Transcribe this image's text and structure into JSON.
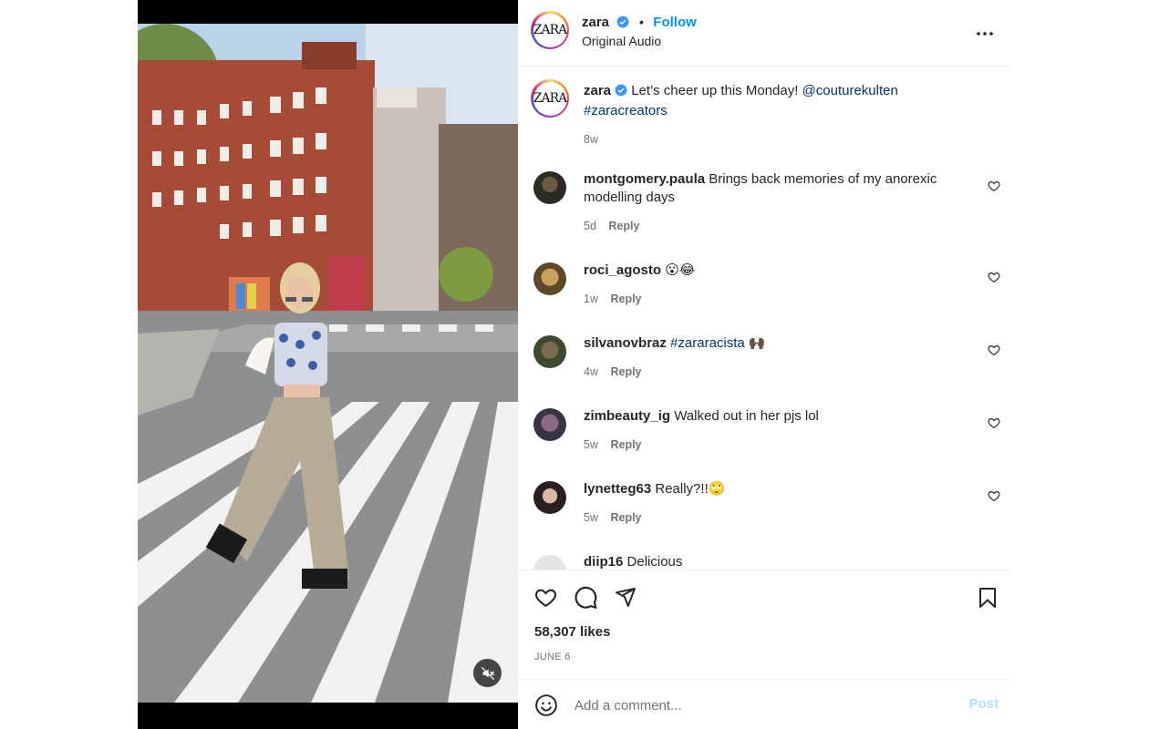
{
  "post": {
    "account": "zara",
    "avatar_text": "ZARA",
    "follow_label": "Follow",
    "separator": "•",
    "audio_label": "Original Audio",
    "more_label": "•••"
  },
  "caption": {
    "username": "zara",
    "text": "Let’s cheer up this Monday!",
    "mention": "@couturekulten",
    "hashtag": "#zaracreators",
    "time": "8w"
  },
  "comments": [
    {
      "username": "montgomery.paula",
      "text": "Brings back memories of my anorexic modelling days",
      "time": "5d",
      "reply": "Reply"
    },
    {
      "username": "roci_agosto",
      "text": "😮😂",
      "time": "1w",
      "reply": "Reply"
    },
    {
      "username": "silvanovbraz",
      "hashtag": "#zararacista",
      "text": "🙌🏿",
      "time": "4w",
      "reply": "Reply"
    },
    {
      "username": "zimbeauty_ig",
      "text": "Walked out in her pjs lol",
      "time": "5w",
      "reply": "Reply"
    },
    {
      "username": "lynetteg63",
      "text": "Really?!!🙄",
      "time": "5w",
      "reply": "Reply"
    },
    {
      "username": "diip16",
      "text": "Delicious"
    }
  ],
  "stats": {
    "likes": "58,307 likes",
    "date": "JUNE 6"
  },
  "composer": {
    "placeholder": "Add a comment...",
    "post_label": "Post"
  },
  "colors": {
    "accent": "#0095f6",
    "verified": "#3897f0",
    "hashtag": "#00376b",
    "muted": "#737373",
    "post_disabled": "#b2dffc"
  },
  "icons": {
    "like": "heart-icon",
    "comment": "comment-icon",
    "share": "share-icon",
    "save": "bookmark-icon",
    "mute": "muted-speaker-icon",
    "emoji": "emoji-icon",
    "more": "more-options-icon",
    "verified": "verified-badge-icon"
  }
}
